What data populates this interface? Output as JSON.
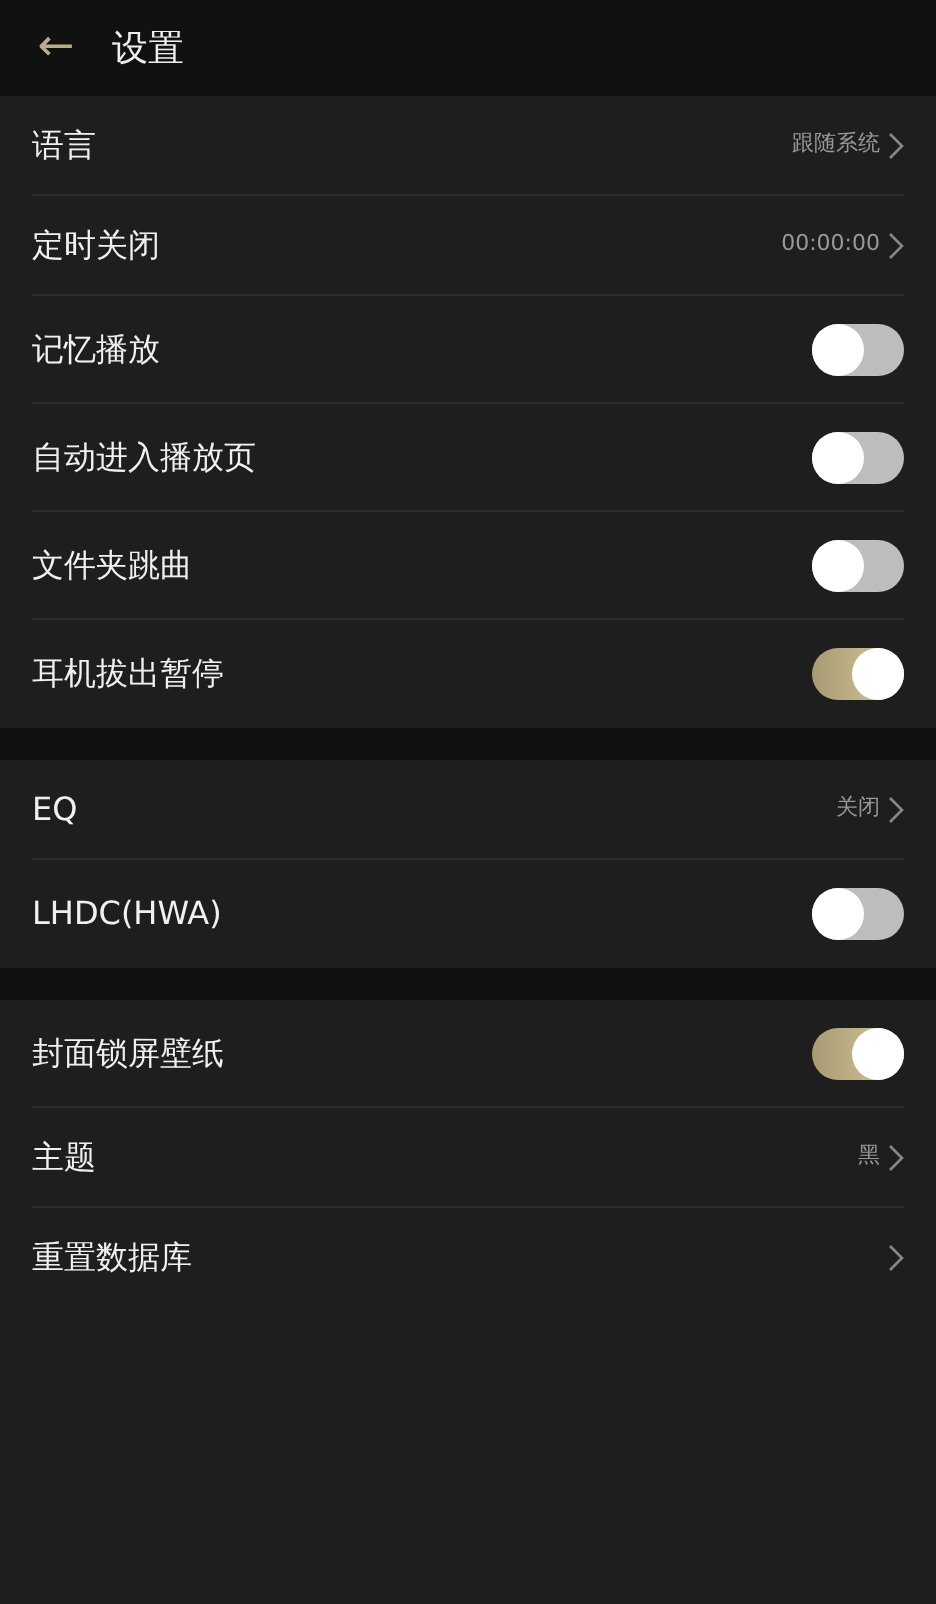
{
  "header": {
    "back": "←",
    "title": "设置"
  },
  "groups": [
    {
      "items": [
        {
          "kind": "link",
          "label": "语言",
          "value": "跟随系统"
        },
        {
          "kind": "link",
          "label": "定时关闭",
          "value": "00:00:00"
        },
        {
          "kind": "toggle",
          "label": "记忆播放",
          "on": false
        },
        {
          "kind": "toggle",
          "label": "自动进入播放页",
          "on": false
        },
        {
          "kind": "toggle",
          "label": "文件夹跳曲",
          "on": false
        },
        {
          "kind": "toggle",
          "label": "耳机拔出暂停",
          "on": true
        }
      ]
    },
    {
      "items": [
        {
          "kind": "link",
          "label": "EQ",
          "value": "关闭"
        },
        {
          "kind": "toggle",
          "label": "LHDC(HWA)",
          "on": false
        }
      ]
    },
    {
      "items": [
        {
          "kind": "toggle",
          "label": "封面锁屏壁纸",
          "on": true
        },
        {
          "kind": "link",
          "label": "主题",
          "value": "黑"
        },
        {
          "kind": "link",
          "label": "重置数据库"
        }
      ]
    }
  ]
}
